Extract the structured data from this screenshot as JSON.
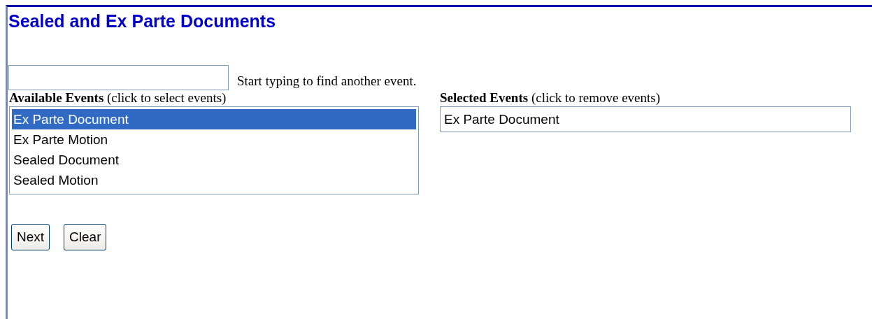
{
  "title": "Sealed and Ex Parte Documents",
  "search": {
    "hint": "Start typing to find another event."
  },
  "available": {
    "label": "**Available Events** (click to select events)",
    "items": [
      {
        "label": "Ex Parte Document",
        "selected": true
      },
      {
        "label": "Ex Parte Motion",
        "selected": false
      },
      {
        "label": "Sealed Document",
        "selected": false
      },
      {
        "label": "Sealed Motion",
        "selected": false
      }
    ]
  },
  "selected_events": {
    "label": "**Selected Events** (click to remove events)",
    "items": [
      {
        "label": "Ex Parte Document"
      }
    ]
  },
  "buttons": [
    "Next",
    "Clear"
  ]
}
